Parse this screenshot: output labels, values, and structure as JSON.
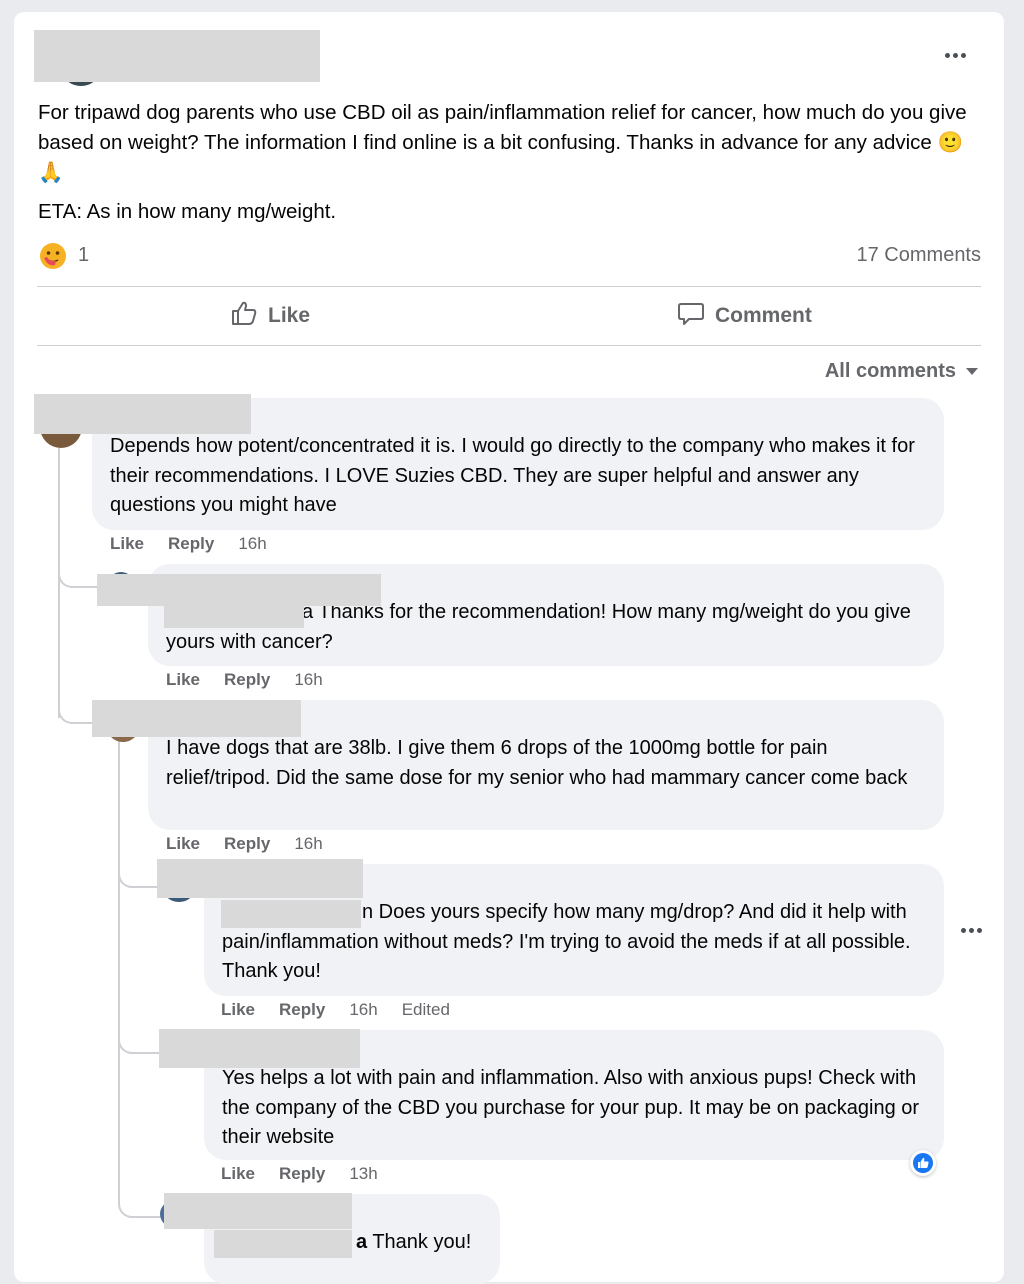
{
  "post": {
    "text_line1": "For tripawd dog parents who use CBD oil as pain/inflammation relief for cancer, how much do you give based on weight? The information I find online is a bit confusing. Thanks in advance for any advice",
    "text_emoji": "🙂🙏",
    "text_eta": "ETA: As in how many mg/weight.",
    "reaction_count": "1",
    "comments_count": "17 Comments"
  },
  "actions": {
    "like_label": "Like",
    "comment_label": "Comment"
  },
  "filter": {
    "label": "All comments"
  },
  "comments": [
    {
      "text": "Depends how potent/concentrated it is. I would go directly to the company who makes it for their recommendations. I LOVE Suzies CBD. They are super helpful and answer any questions you might have",
      "like": "Like",
      "reply": "Reply",
      "time": "16h"
    },
    {
      "mention_tail": "a",
      "text": " Thanks for the recommendation! How many mg/weight do you give yours with cancer?",
      "like": "Like",
      "reply": "Reply",
      "time": "16h"
    },
    {
      "text": "I have dogs that are 38lb. I give them 6 drops of the 1000mg bottle for pain relief/tripod. Did the same dose for my senior who had mammary cancer come back",
      "like": "Like",
      "reply": "Reply",
      "time": "16h"
    },
    {
      "mention_tail": "n",
      "text": " Does yours specify how many mg/drop? And did it help with pain/inflammation without meds? I'm trying to avoid the meds if at all possible. Thank you!",
      "like": "Like",
      "reply": "Reply",
      "time": "16h",
      "edited": "Edited"
    },
    {
      "text": "Yes helps a lot with pain and inflammation. Also with anxious pups! Check with the company of the CBD you purchase for your pup. It may be on packaging or their website",
      "like": "Like",
      "reply": "Reply",
      "time": "13h"
    },
    {
      "mention_tail": "a",
      "text": " Thank you!"
    }
  ],
  "colors": {
    "page_bg": "#e9ebef",
    "card_bg": "#ffffff",
    "bubble_bg": "#f0f2f5",
    "secondary_text": "#65676b",
    "like_blue": "#1877f2",
    "redaction": "#d9d9d9"
  },
  "icons": {
    "reaction": "care-emoji-icon",
    "like": "thumbs-up-outline-icon",
    "comment": "speech-bubble-icon",
    "more": "more-dots-icon",
    "filter_caret": "caret-down-icon",
    "comment_reaction": "like-badge-icon"
  }
}
